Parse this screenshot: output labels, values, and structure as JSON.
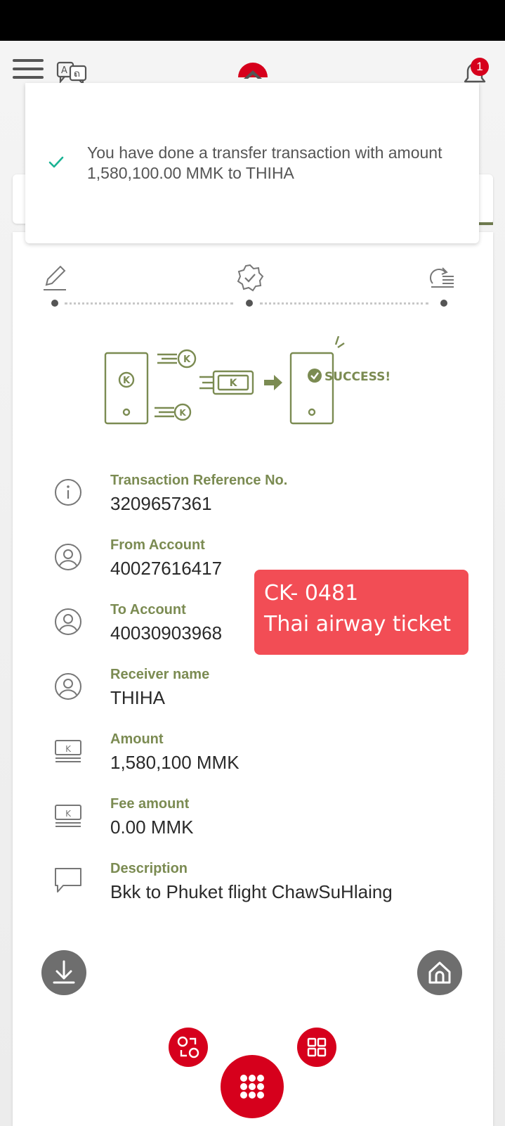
{
  "header": {
    "notification_count": "1"
  },
  "toast": {
    "message": "You have done a transfer transaction with amount 1,580,100.00 MMK to THIHA"
  },
  "illustration": {
    "coin_letter": "K",
    "success_text": "SUCCESS!"
  },
  "details": [
    {
      "label": "Transaction Reference No.",
      "value": "3209657361",
      "icon": "info-icon"
    },
    {
      "label": "From Account",
      "value": "40027616417",
      "icon": "user-icon"
    },
    {
      "label": "To Account",
      "value": "40030903968",
      "icon": "user-icon"
    },
    {
      "label": "Receiver name",
      "value": "THIHA",
      "icon": "user-icon"
    },
    {
      "label": "Amount",
      "value": "1,580,100 MMK",
      "icon": "money-icon"
    },
    {
      "label": "Fee amount",
      "value": "0.00 MMK",
      "icon": "money-icon"
    },
    {
      "label": "Description",
      "value": "Bkk to Phuket flight ChawSuHlaing",
      "icon": "comment-icon"
    }
  ],
  "overlay": {
    "line1": "CK- 0481",
    "line2": "Thai airway ticket"
  },
  "colors": {
    "brand_red": "#d6001c",
    "label_green": "#7b8b52",
    "overlay_red": "#f24d55",
    "check_teal": "#1ab394"
  }
}
